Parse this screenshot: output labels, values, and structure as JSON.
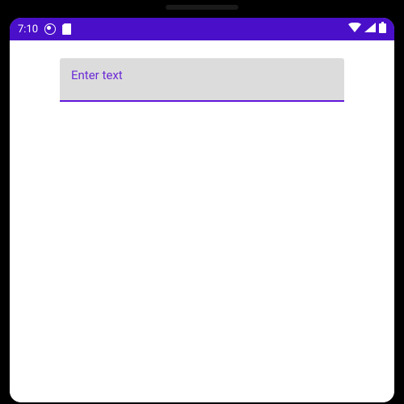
{
  "status_bar": {
    "time": "7:10",
    "icons_left": [
      "profile-icon",
      "sd-card-icon"
    ],
    "icons_right": [
      "wifi-icon",
      "signal-icon",
      "battery-icon"
    ]
  },
  "content": {
    "text_input": {
      "placeholder": "Enter text",
      "value": ""
    }
  },
  "colors": {
    "status_bar_bg": "#4a0fc8",
    "accent": "#5e17d8",
    "input_bg": "#dcdcdc"
  }
}
